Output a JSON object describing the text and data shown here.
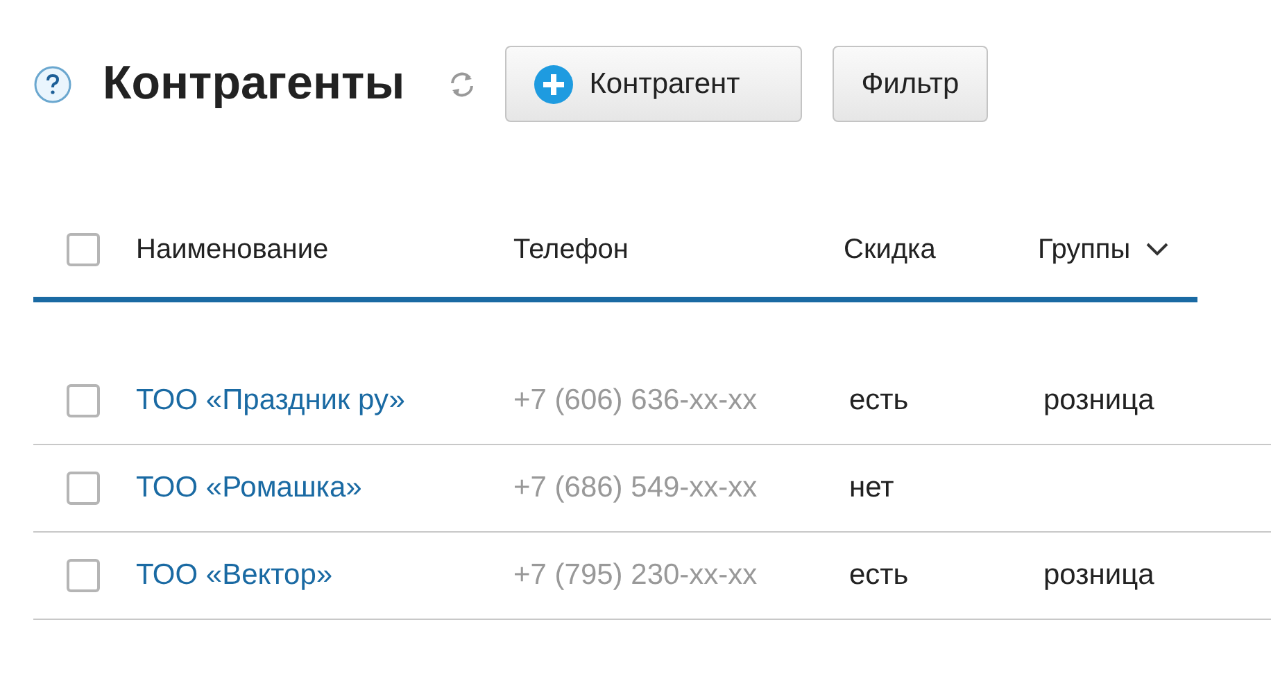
{
  "title": "Контрагенты",
  "buttons": [
    {
      "kind": "add",
      "label": "Контрагент"
    },
    {
      "kind": "plain",
      "label": "Фильтр"
    }
  ],
  "table": {
    "select_all": {
      "checked": false
    },
    "columns": [
      {
        "label": "Наименование"
      },
      {
        "label": "Телефон"
      },
      {
        "label": "Скидка"
      },
      {
        "label": "Группы",
        "sortable": true
      }
    ],
    "rows": [
      {
        "checked": false,
        "name": "ТОО «Праздник ру»",
        "phone": "+7 (606) 636-xx-xx",
        "discount": "есть",
        "group": "розница"
      },
      {
        "checked": false,
        "name": "ТОО «Ромашка»",
        "phone": "+7 (686) 549-xx-xx",
        "discount": "нет"
      },
      {
        "checked": false,
        "name": "ТОО «Вектор»",
        "phone": "+7 (795) 230-xx-xx",
        "discount": "есть",
        "group": "розница"
      }
    ]
  }
}
